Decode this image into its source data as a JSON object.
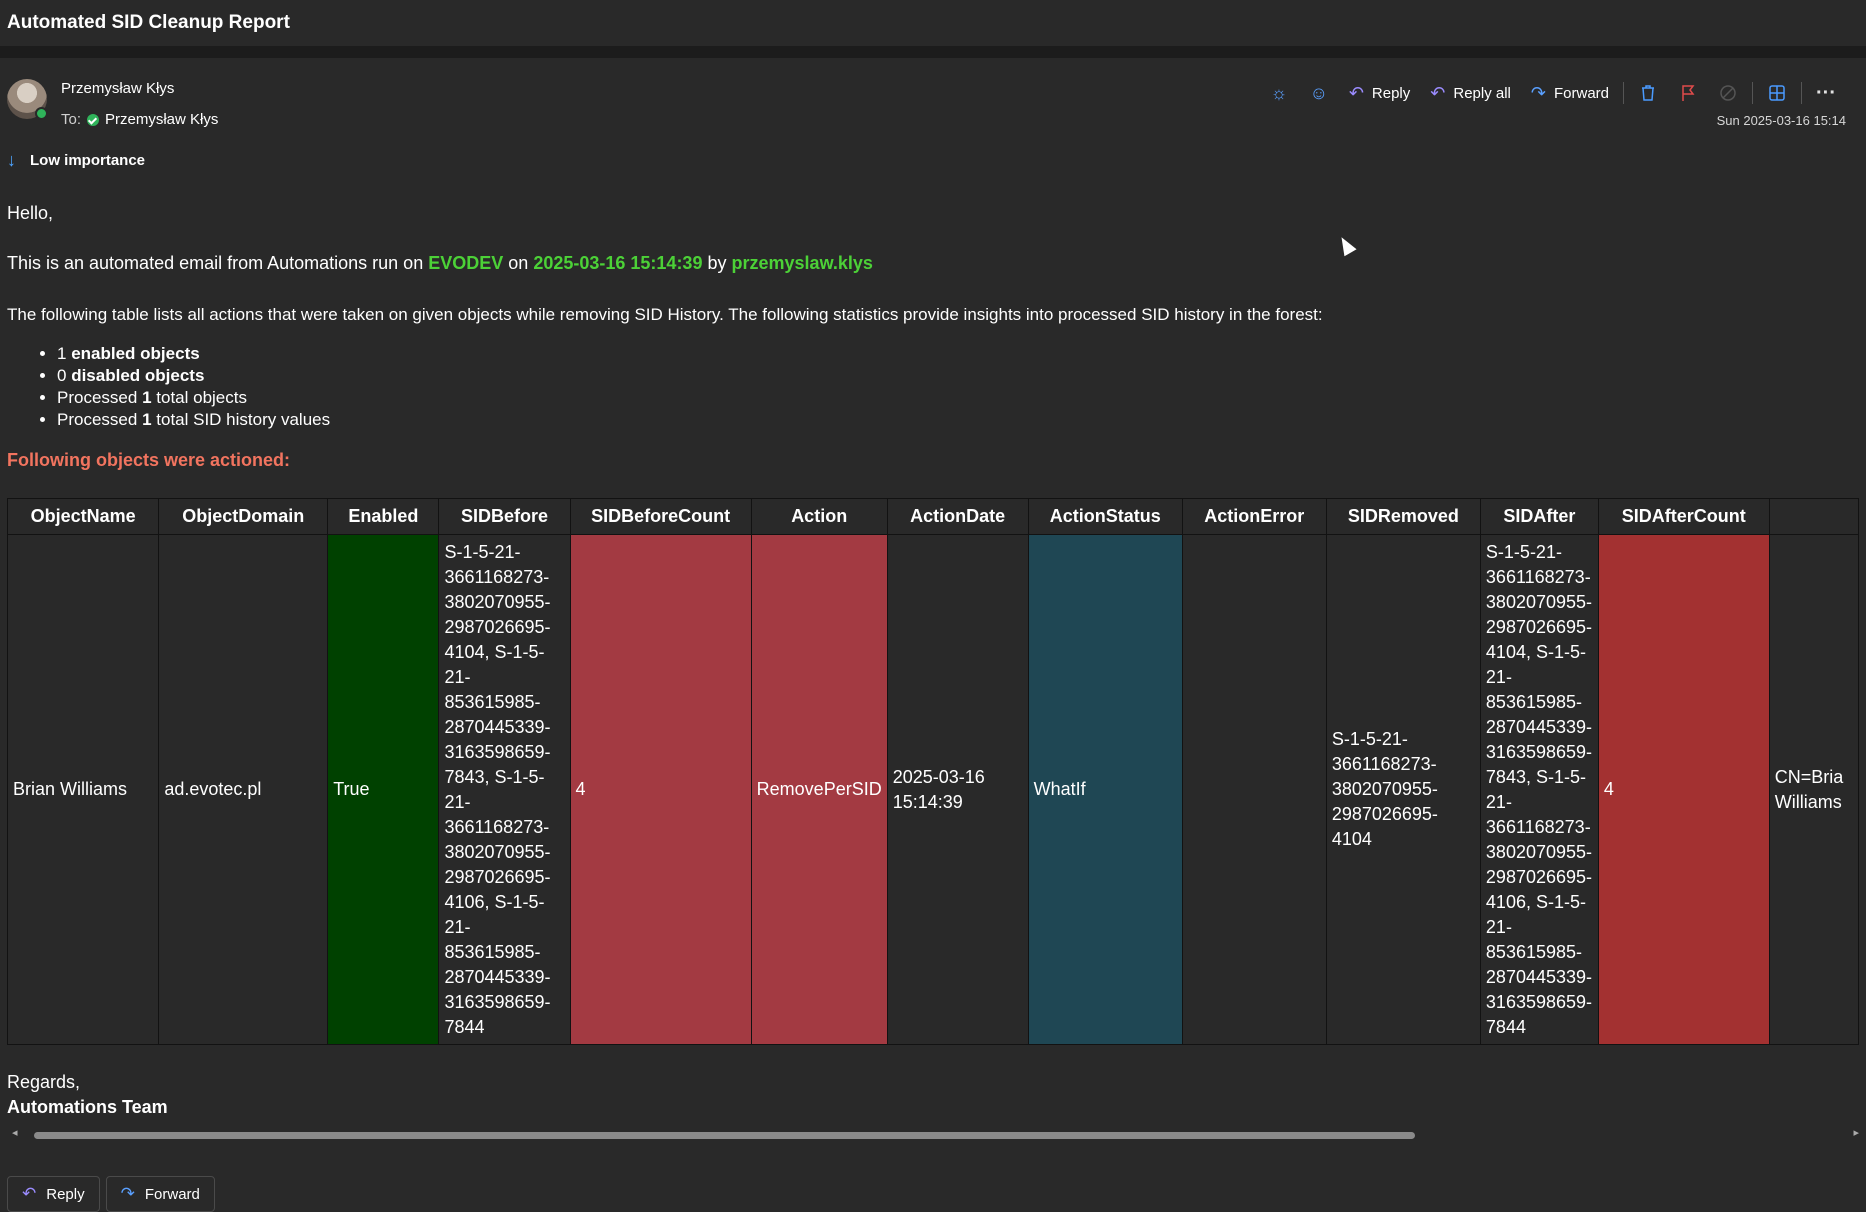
{
  "window": {
    "title": "Automated SID Cleanup Report"
  },
  "header": {
    "sender": "Przemysław Kłys",
    "to_label": "To:",
    "recipient": "Przemysław Kłys",
    "importance": "Low importance",
    "date": "Sun 2025-03-16 15:14"
  },
  "toolbar": {
    "brightness_icon": "sun-icon",
    "emoji_icon": "smiley-icon",
    "reply_label": "Reply",
    "reply_all_label": "Reply all",
    "forward_label": "Forward",
    "delete_icon": "trash-icon",
    "flag_icon": "flag-icon",
    "block_icon": "block-icon",
    "apps_icon": "apps-icon",
    "more_icon": "more-icon"
  },
  "body": {
    "greeting": "Hello,",
    "intro_prefix": "This is an automated email from Automations run on",
    "host": "EVODEV",
    "on_word": "on",
    "run_date": "2025-03-16 15:14:39",
    "by_word": "by",
    "user": "przemyslaw.klys",
    "description": "The following table lists all actions that were taken on given objects while removing SID History. The following statistics provide insights into processed SID history in the forest:",
    "stats": [
      {
        "n": "1",
        "text": "enabled objects"
      },
      {
        "n": "0",
        "text": "disabled objects"
      },
      {
        "pre": "Processed",
        "n": "1",
        "text": "total objects"
      },
      {
        "pre": "Processed",
        "n": "1",
        "text": "total SID history values"
      }
    ],
    "actioned_heading": "Following objects were actioned:",
    "regards": "Regards,",
    "team": "Automations Team"
  },
  "table": {
    "headers": [
      "ObjectName",
      "ObjectDomain",
      "Enabled",
      "SIDBefore",
      "SIDBeforeCount",
      "Action",
      "ActionDate",
      "ActionStatus",
      "ActionError",
      "SIDRemoved",
      "SIDAfter",
      "SIDAfterCount",
      ""
    ],
    "row": {
      "ObjectName": "Brian Williams",
      "ObjectDomain": "ad.evotec.pl",
      "Enabled": "True",
      "SIDBefore": "S-1-5-21-3661168273-3802070955-2987026695-4104, S-1-5-21-853615985-2870445339-3163598659-7843, S-1-5-21-3661168273-3802070955-2987026695-4106, S-1-5-21-853615985-2870445339-3163598659-7844",
      "SIDBeforeCount": "4",
      "Action": "RemovePerSID",
      "ActionDate": "2025-03-16 15:14:39",
      "ActionStatus": "WhatIf",
      "ActionError": "",
      "SIDRemoved": "S-1-5-21-3661168273-3802070955-2987026695-4104",
      "SIDAfter": "S-1-5-21-3661168273-3802070955-2987026695-4104, S-1-5-21-853615985-2870445339-3163598659-7843, S-1-5-21-3661168273-3802070955-2987026695-4106, S-1-5-21-853615985-2870445339-3163598659-7844",
      "SIDAfterCount": "4",
      "Extra": "CN=Bria Williams"
    }
  },
  "footer": {
    "reply_label": "Reply",
    "forward_label": "Forward"
  },
  "colors": {
    "background": "#292929",
    "highlight_green": "#4cd137",
    "heading_salmon": "#f2745f",
    "cell_green": "#004100",
    "cell_red": "#a33a42",
    "cell_teal": "#1f4754"
  }
}
